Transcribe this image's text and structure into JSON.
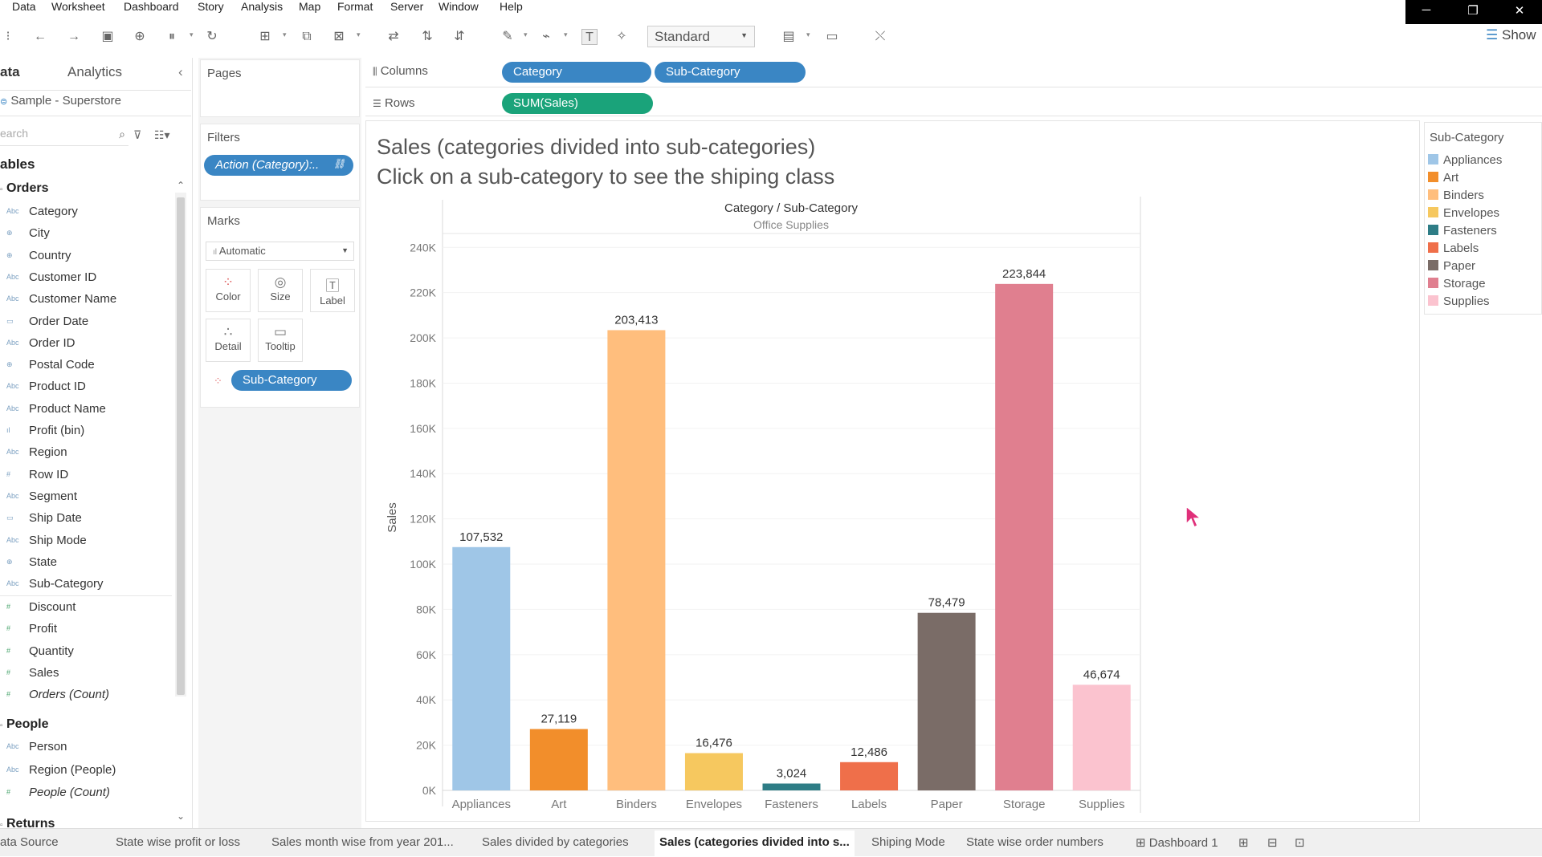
{
  "menu": [
    "Data",
    "Worksheet",
    "Dashboard",
    "Story",
    "Analysis",
    "Map",
    "Format",
    "Server",
    "Window",
    "Help"
  ],
  "window_controls": {
    "minimize": "─",
    "restore": "❐",
    "close": "✕"
  },
  "toolbar": {
    "fit_select": "Standard",
    "show_me": "Show"
  },
  "left_pane": {
    "tab_data": "ata",
    "tab_analytics": "Analytics",
    "collapse": "‹",
    "datasource": "Sample - Superstore",
    "search_placeholder": "earch",
    "tables_header": "ables",
    "groups": {
      "orders": "Orders",
      "people": "People",
      "returns": "Returns"
    },
    "order_dims": [
      {
        "icon": "Abc",
        "name": "Category"
      },
      {
        "icon": "⊕",
        "name": "City"
      },
      {
        "icon": "⊕",
        "name": "Country"
      },
      {
        "icon": "Abc",
        "name": "Customer ID"
      },
      {
        "icon": "Abc",
        "name": "Customer Name"
      },
      {
        "icon": "▭",
        "name": "Order Date"
      },
      {
        "icon": "Abc",
        "name": "Order ID"
      },
      {
        "icon": "⊕",
        "name": "Postal Code"
      },
      {
        "icon": "Abc",
        "name": "Product ID"
      },
      {
        "icon": "Abc",
        "name": "Product Name"
      },
      {
        "icon": "ıl",
        "name": "Profit (bin)"
      },
      {
        "icon": "Abc",
        "name": "Region"
      },
      {
        "icon": "#",
        "name": "Row ID"
      },
      {
        "icon": "Abc",
        "name": "Segment"
      },
      {
        "icon": "▭",
        "name": "Ship Date"
      },
      {
        "icon": "Abc",
        "name": "Ship Mode"
      },
      {
        "icon": "⊕",
        "name": "State"
      },
      {
        "icon": "Abc",
        "name": "Sub-Category"
      }
    ],
    "order_measures": [
      {
        "icon": "#",
        "name": "Discount"
      },
      {
        "icon": "#",
        "name": "Profit"
      },
      {
        "icon": "#",
        "name": "Quantity"
      },
      {
        "icon": "#",
        "name": "Sales"
      },
      {
        "icon": "#",
        "name": "Orders (Count)"
      }
    ],
    "people_fields": [
      {
        "icon": "Abc",
        "name": "Person"
      },
      {
        "icon": "Abc",
        "name": "Region (People)"
      },
      {
        "icon": "#",
        "name": "People (Count)"
      }
    ]
  },
  "cards": {
    "pages": "Pages",
    "filters": "Filters",
    "filter_pill": "Action (Category):..",
    "marks": "Marks",
    "mark_type": "Automatic",
    "mark_buttons": [
      "Color",
      "Size",
      "Label",
      "Detail",
      "Tooltip"
    ],
    "marks_pill": "Sub-Category"
  },
  "shelves": {
    "columns_label": "Columns",
    "rows_label": "Rows",
    "columns_pills": [
      "Category",
      "Sub-Category"
    ],
    "rows_pill": "SUM(Sales)"
  },
  "view": {
    "title_line1": "Sales (categories divided into sub-categories)",
    "title_line2": "Click on a sub-category to see the shiping class",
    "header_top": "Category / Sub-Category",
    "header_sub": "Office Supplies"
  },
  "chart_data": {
    "type": "bar",
    "title": "Sales (categories divided into sub-categories)",
    "xlabel": "",
    "ylabel": "Sales",
    "ylim": [
      0,
      250000
    ],
    "yticks": [
      "0K",
      "20K",
      "40K",
      "60K",
      "80K",
      "100K",
      "120K",
      "140K",
      "160K",
      "180K",
      "200K",
      "220K",
      "240K"
    ],
    "categories": [
      "Appliances",
      "Art",
      "Binders",
      "Envelopes",
      "Fasteners",
      "Labels",
      "Paper",
      "Storage",
      "Supplies"
    ],
    "values": [
      107532,
      27119,
      203413,
      16476,
      3024,
      12486,
      78479,
      223844,
      46674
    ],
    "value_labels": [
      "107,532",
      "27,119",
      "203,413",
      "16,476",
      "3,024",
      "12,486",
      "78,479",
      "223,844",
      "46,674"
    ],
    "colors": [
      "#9fc6e7",
      "#f28e2b",
      "#ffbe7d",
      "#f6c85f",
      "#2e7d86",
      "#ef6f4a",
      "#7a6c67",
      "#e07f8f",
      "#fbc3cf"
    ],
    "grid": true,
    "legend": "right"
  },
  "legend": {
    "title": "Sub-Category",
    "items": [
      "Appliances",
      "Art",
      "Binders",
      "Envelopes",
      "Fasteners",
      "Labels",
      "Paper",
      "Storage",
      "Supplies"
    ]
  },
  "bottom_tabs": [
    "ata Source",
    "State wise profit or loss",
    "Sales month wise from year 201...",
    "Sales divided by categories",
    "Sales (categories divided into s...",
    "Shiping Mode",
    "State wise order numbers",
    "Dashboard 1"
  ]
}
